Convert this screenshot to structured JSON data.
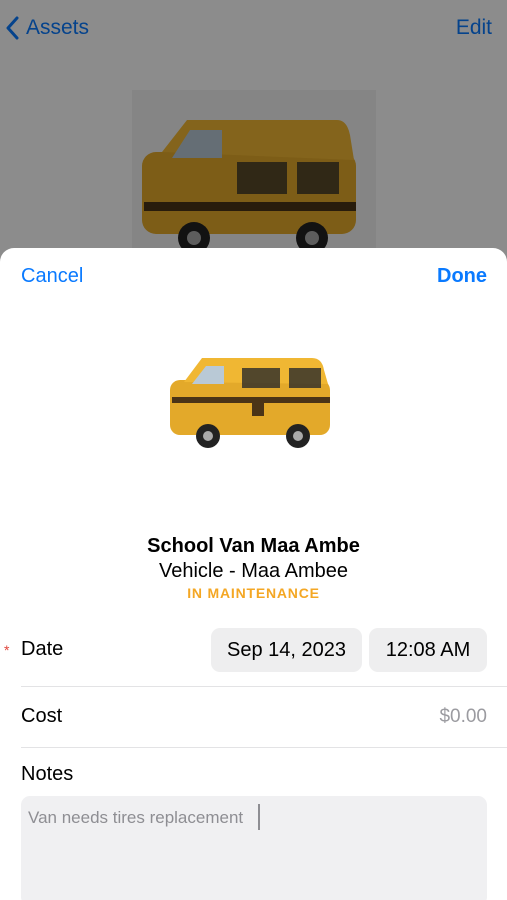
{
  "background": {
    "nav": {
      "back_label": "Assets",
      "edit_label": "Edit"
    },
    "photo_icon": "school-van-photo"
  },
  "sheet": {
    "cancel_label": "Cancel",
    "done_label": "Done",
    "photo_icon": "school-van-photo",
    "asset": {
      "name": "School Van Maa Ambe",
      "subtitle": "Vehicle - Maa Ambee",
      "status": "IN MAINTENANCE"
    },
    "date_row": {
      "label": "Date",
      "required_mark": "*",
      "date": "Sep 14, 2023",
      "time": "12:08 AM"
    },
    "cost_row": {
      "label": "Cost",
      "value": "$0.00"
    },
    "notes": {
      "label": "Notes",
      "value": "Van needs tires replacement"
    }
  },
  "colors": {
    "accent": "#0a7aff",
    "status": "#f4a724",
    "required": "#e0443c"
  }
}
